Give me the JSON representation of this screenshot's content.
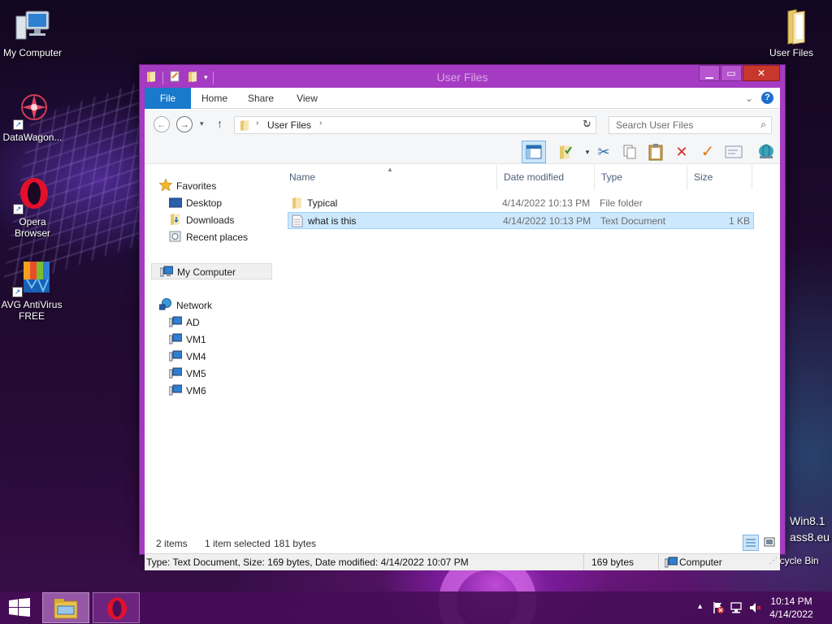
{
  "desktop": {
    "icons": [
      {
        "label": "My Computer"
      },
      {
        "label": "DataWagon..."
      },
      {
        "label": "Opera\nBrowser"
      },
      {
        "label": "AVG AntiVirus\nFREE"
      },
      {
        "label": "User Files"
      },
      {
        "label": "Recycle Bin"
      }
    ],
    "watermark_line1": "Win8.1",
    "watermark_line2": "ass8.eu"
  },
  "window": {
    "title": "User Files",
    "ribbon_tabs": [
      "File",
      "Home",
      "Share",
      "View"
    ],
    "address": {
      "crumb": "User Files"
    },
    "search": {
      "placeholder": "Search User Files"
    },
    "navpane": {
      "favorites": {
        "label": "Favorites",
        "items": [
          "Desktop",
          "Downloads",
          "Recent places"
        ]
      },
      "computer": {
        "label": "My Computer"
      },
      "network": {
        "label": "Network",
        "items": [
          "AD",
          "VM1",
          "VM4",
          "VM5",
          "VM6"
        ]
      }
    },
    "columns": [
      "Name",
      "Date modified",
      "Type",
      "Size"
    ],
    "files": [
      {
        "name": "Typical",
        "date": "4/14/2022 10:13 PM",
        "type": "File folder",
        "size": ""
      },
      {
        "name": "what is this",
        "date": "4/14/2022 10:13 PM",
        "type": "Text Document",
        "size": "1 KB"
      }
    ],
    "status": {
      "items_count": "2 items",
      "selection": "1 item selected",
      "selection_size": "181 bytes",
      "details": "Type: Text Document, Size: 169 bytes, Date modified: 4/14/2022 10:07 PM",
      "size": "169 bytes",
      "location": "Computer"
    }
  },
  "taskbar": {
    "time": "10:14 PM",
    "date": "4/14/2022"
  },
  "colors": {
    "window_frame": "#a53bc2",
    "file_tab": "#1979ca",
    "selection": "#cce8ff",
    "taskbar": "#460c56"
  }
}
